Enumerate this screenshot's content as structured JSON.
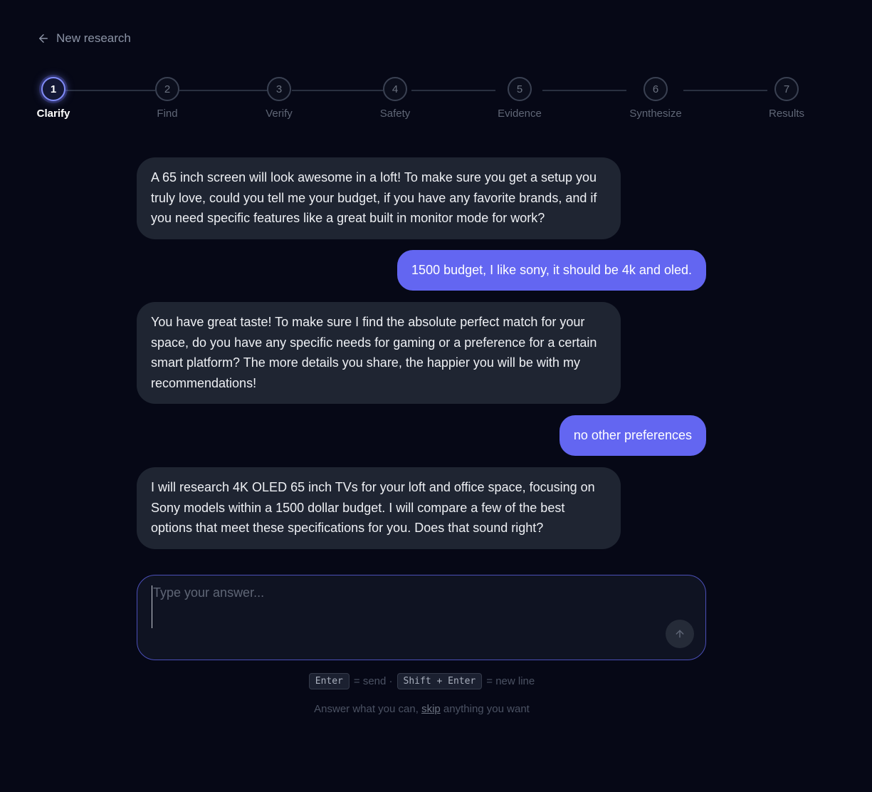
{
  "header": {
    "back_label": "New research"
  },
  "stepper": {
    "steps": [
      {
        "number": "1",
        "label": "Clarify",
        "active": true
      },
      {
        "number": "2",
        "label": "Find"
      },
      {
        "number": "3",
        "label": "Verify"
      },
      {
        "number": "4",
        "label": "Safety"
      },
      {
        "number": "5",
        "label": "Evidence"
      },
      {
        "number": "6",
        "label": "Synthesize"
      },
      {
        "number": "7",
        "label": "Results"
      }
    ]
  },
  "messages": [
    {
      "role": "assistant",
      "text": "A 65 inch screen will look awesome in a loft! To make sure you get a setup you truly love, could you tell me your budget, if you have any favorite brands, and if you need specific features like a great built in monitor mode for work?"
    },
    {
      "role": "user",
      "text": "1500 budget, I like sony, it should be 4k and oled."
    },
    {
      "role": "assistant",
      "text": "You have great taste! To make sure I find the absolute perfect match for your space, do you have any specific needs for gaming or a preference for a certain smart platform? The more details you share, the happier you will be with my recommendations!"
    },
    {
      "role": "user",
      "text": "no other preferences"
    },
    {
      "role": "assistant",
      "text": "I will research 4K OLED 65 inch TVs for your loft and office space, focusing on Sony models within a 1500 dollar budget. I will compare a few of the best options that meet these specifications for you. Does that sound right?"
    }
  ],
  "composer": {
    "value": "",
    "placeholder": "Type your answer..."
  },
  "hints": {
    "send_key": "Enter",
    "send_text": "= send ·",
    "newline_key": "Shift + Enter",
    "newline_text": "= new line"
  },
  "footnote": {
    "before": "Answer what you can, ",
    "link": "skip",
    "after": " anything you want"
  },
  "colors": {
    "background": "#060816",
    "accent": "#6366f1",
    "assistant_bubble": "#1f2532"
  }
}
